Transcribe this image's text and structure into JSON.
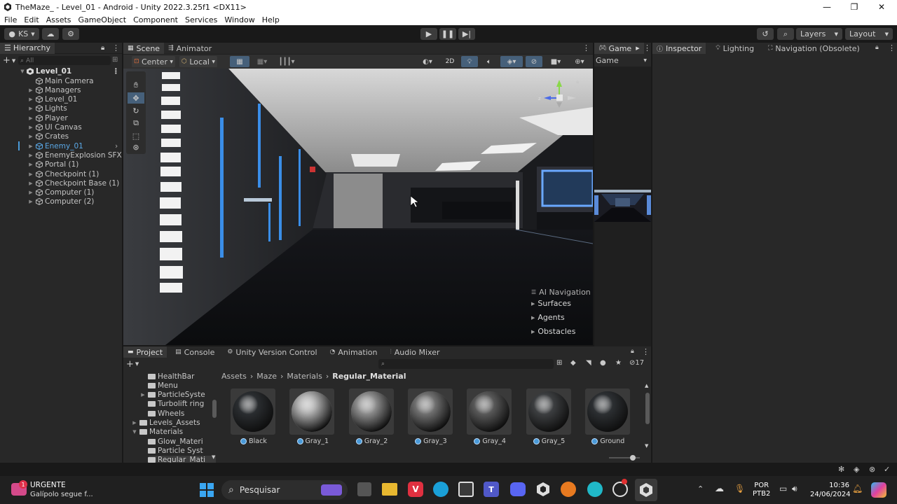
{
  "window": {
    "title": "TheMaze_ - Level_01 - Android - Unity 2022.3.25f1 <DX11>",
    "minimize": "—",
    "maximize": "❐",
    "close": "✕"
  },
  "menu": [
    "File",
    "Edit",
    "Assets",
    "GameObject",
    "Component",
    "Services",
    "Window",
    "Help"
  ],
  "toolbar": {
    "account": "KS",
    "layers": "Layers",
    "layout": "Layout"
  },
  "hierarchy": {
    "tab": "Hierarchy",
    "search_placeholder": "All",
    "scene": "Level_01",
    "items": [
      {
        "label": "Main Camera",
        "expand": false
      },
      {
        "label": "Managers",
        "expand": true
      },
      {
        "label": "Level_01",
        "expand": true
      },
      {
        "label": "Lights",
        "expand": true
      },
      {
        "label": "Player",
        "expand": true
      },
      {
        "label": "UI Canvas",
        "expand": true
      },
      {
        "label": "Crates",
        "expand": true
      },
      {
        "label": "Enemy_01",
        "expand": true,
        "prefab": true
      },
      {
        "label": "EnemyExplosion SFX",
        "expand": true
      },
      {
        "label": "Portal (1)",
        "expand": true
      },
      {
        "label": "Checkpoint (1)",
        "expand": true
      },
      {
        "label": "Checkpoint Base (1)",
        "expand": true
      },
      {
        "label": "Computer (1)",
        "expand": true
      },
      {
        "label": "Computer (2)",
        "expand": true
      }
    ]
  },
  "scene_view": {
    "tabs": [
      "Scene",
      "Animator"
    ],
    "pivot": "Center",
    "space": "Local",
    "mode_2d": "2D",
    "ai_nav": {
      "title": "AI Navigation",
      "items": [
        "Surfaces",
        "Agents",
        "Obstacles"
      ]
    }
  },
  "game_view": {
    "tab": "Game",
    "display": "Game"
  },
  "inspector": {
    "tabs": [
      "Inspector",
      "Lighting",
      "Navigation (Obsolete)"
    ]
  },
  "project": {
    "tabs": [
      "Project",
      "Console",
      "Unity Version Control",
      "Animation",
      "Audio Mixer"
    ],
    "count": "17",
    "breadcrumb": [
      "Assets",
      "Maze",
      "Materials",
      "Regular_Material"
    ],
    "folders": [
      {
        "label": "HealthBar",
        "indent": 2,
        "expand": false
      },
      {
        "label": "Menu",
        "indent": 2,
        "expand": false
      },
      {
        "label": "ParticleSyste",
        "indent": 2,
        "expand": true
      },
      {
        "label": "Turbolift ring",
        "indent": 2,
        "expand": false
      },
      {
        "label": "Wheels",
        "indent": 2,
        "expand": false
      },
      {
        "label": "Levels_Assets",
        "indent": 1,
        "expand": true
      },
      {
        "label": "Materials",
        "indent": 1,
        "expand": "open"
      },
      {
        "label": "Glow_Materi",
        "indent": 2,
        "expand": false
      },
      {
        "label": "Particle Syst",
        "indent": 2,
        "expand": false
      },
      {
        "label": "Regular_Mati",
        "indent": 2,
        "expand": false
      }
    ],
    "materials": [
      {
        "label": "Black",
        "shade": "#2a2d30"
      },
      {
        "label": "Gray_1",
        "shade": "#a8a8a8"
      },
      {
        "label": "Gray_2",
        "shade": "#8a8a8a"
      },
      {
        "label": "Gray_3",
        "shade": "#6f6f6f"
      },
      {
        "label": "Gray_4",
        "shade": "#585858"
      },
      {
        "label": "Gray_5",
        "shade": "#3c3e40"
      },
      {
        "label": "Ground",
        "shade": "#2c2f32"
      }
    ]
  },
  "taskbar": {
    "news_title": "URGENTE",
    "news_sub": "Galípolo segue f...",
    "news_badge": "1",
    "search": "Pesquisar",
    "lang": "POR",
    "lang2": "PTB2",
    "time": "10:36",
    "date": "24/06/2024"
  },
  "colors": {
    "accent": "#4a9ad8",
    "selected_text": "#5aa8e6"
  }
}
